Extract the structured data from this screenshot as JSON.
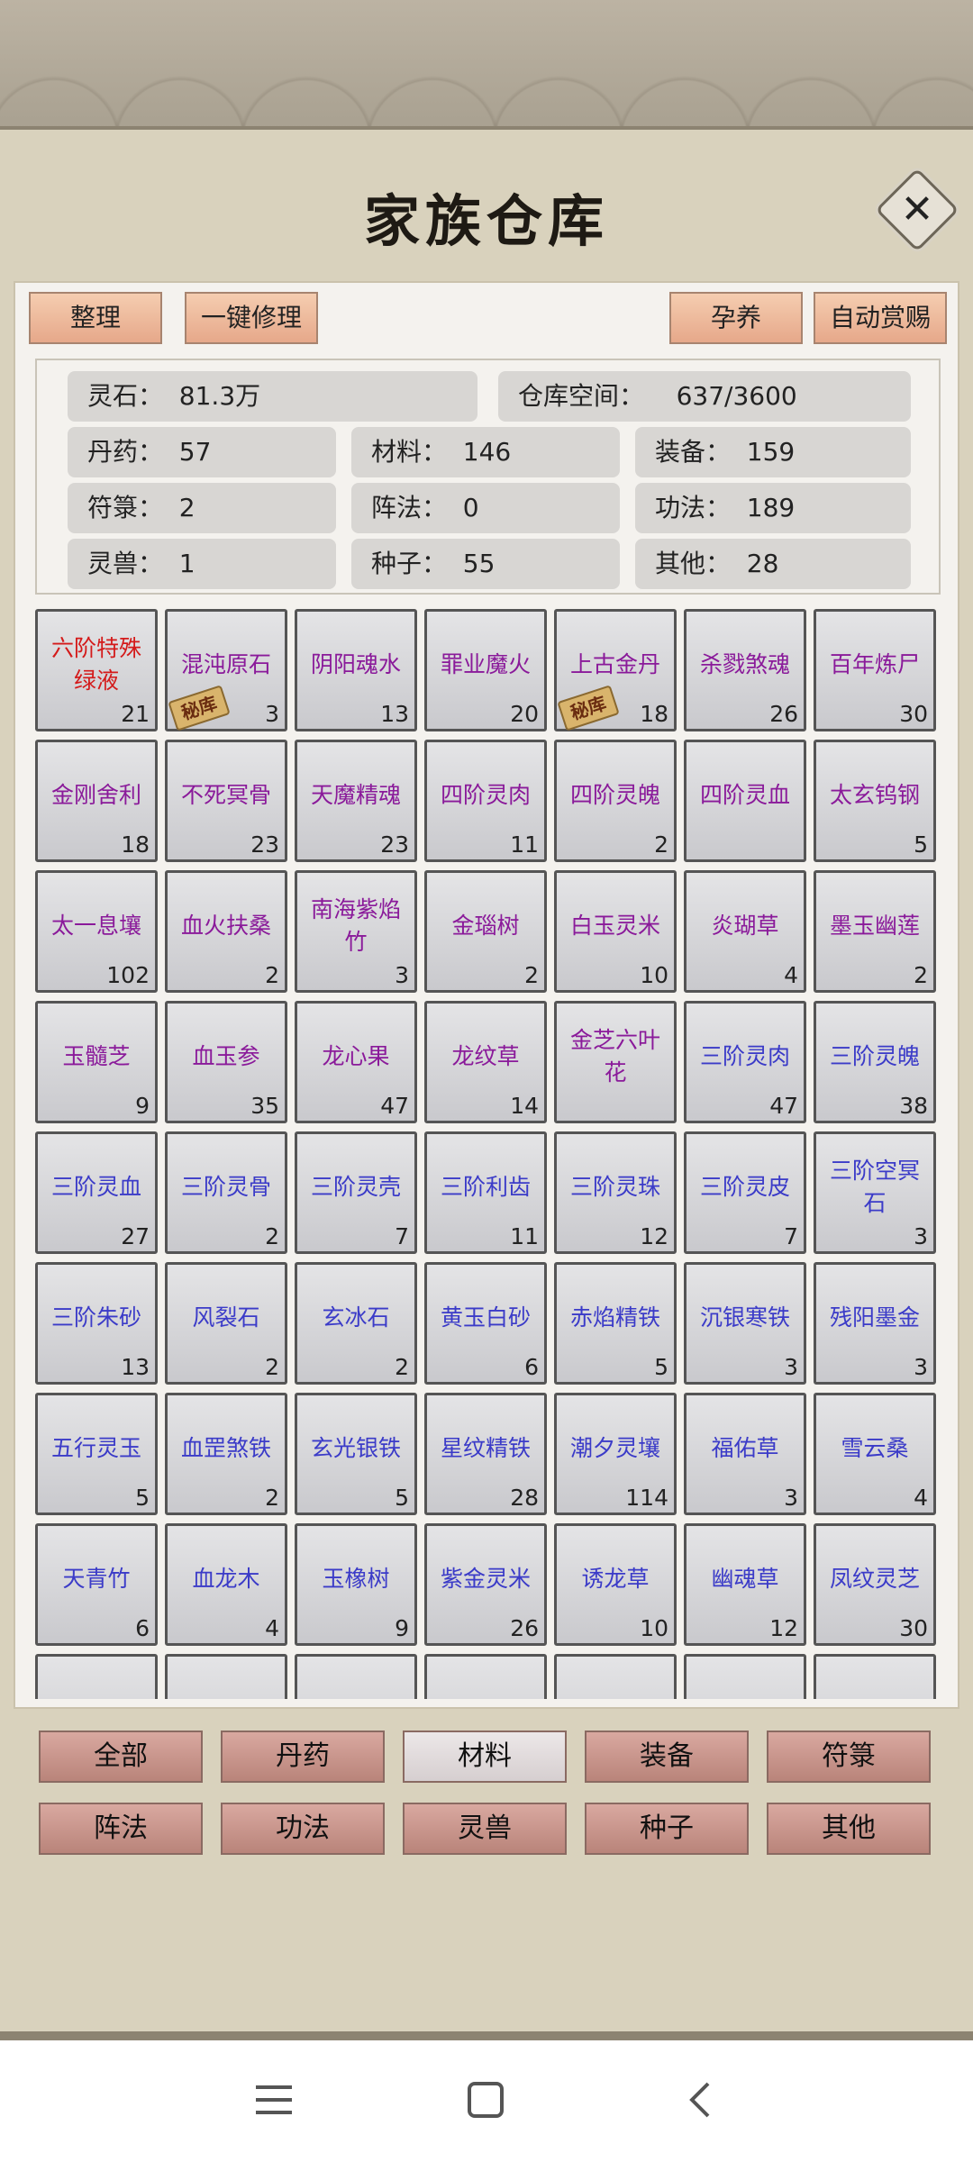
{
  "title": "家族仓库",
  "toolbar": {
    "sort": "整理",
    "repair_all": "一键修理",
    "nurture": "孕养",
    "auto_reward": "自动赏赐"
  },
  "stats": {
    "spirit_stone": "灵石：  81.3万",
    "storage": "仓库空间：    637/3600",
    "pills": "丹药：  57",
    "materials": "材料：  146",
    "equipment": "装备：  159",
    "talismans": "符箓：  2",
    "formations": "阵法：  0",
    "techniques": "功法：  189",
    "beasts": "灵兽：  1",
    "seeds": "种子：  55",
    "other": "其他：  28"
  },
  "stamp_label": "秘库",
  "items": [
    {
      "name": "六阶特殊绿液",
      "count": "21",
      "color": "#d41a1a",
      "stamp": false
    },
    {
      "name": "混沌原石",
      "count": "3",
      "color": "#8a1a9a",
      "stamp": true
    },
    {
      "name": "阴阳魂水",
      "count": "13",
      "color": "#8a1a9a",
      "stamp": false
    },
    {
      "name": "罪业魔火",
      "count": "20",
      "color": "#8a1a9a",
      "stamp": false
    },
    {
      "name": "上古金丹",
      "count": "18",
      "color": "#8a1a9a",
      "stamp": true
    },
    {
      "name": "杀戮煞魂",
      "count": "26",
      "color": "#8a1a9a",
      "stamp": false
    },
    {
      "name": "百年炼尸",
      "count": "30",
      "color": "#8a1a9a",
      "stamp": false
    },
    {
      "name": "金刚舍利",
      "count": "18",
      "color": "#8a1a9a",
      "stamp": false
    },
    {
      "name": "不死冥骨",
      "count": "23",
      "color": "#8a1a9a",
      "stamp": false
    },
    {
      "name": "天魔精魂",
      "count": "23",
      "color": "#8a1a9a",
      "stamp": false
    },
    {
      "name": "四阶灵肉",
      "count": "11",
      "color": "#8a1a9a",
      "stamp": false
    },
    {
      "name": "四阶灵魄",
      "count": "2",
      "color": "#8a1a9a",
      "stamp": false
    },
    {
      "name": "四阶灵血",
      "count": "",
      "color": "#8a1a9a",
      "stamp": false
    },
    {
      "name": "太玄钨钢",
      "count": "5",
      "color": "#8a1a9a",
      "stamp": false
    },
    {
      "name": "太一息壤",
      "count": "102",
      "color": "#8a1a9a",
      "stamp": false
    },
    {
      "name": "血火扶桑",
      "count": "2",
      "color": "#8a1a9a",
      "stamp": false
    },
    {
      "name": "南海紫焰竹",
      "count": "3",
      "color": "#8a1a9a",
      "stamp": false
    },
    {
      "name": "金瑙树",
      "count": "2",
      "color": "#8a1a9a",
      "stamp": false
    },
    {
      "name": "白玉灵米",
      "count": "10",
      "color": "#8a1a9a",
      "stamp": false
    },
    {
      "name": "炎瑚草",
      "count": "4",
      "color": "#8a1a9a",
      "stamp": false
    },
    {
      "name": "墨玉幽莲",
      "count": "2",
      "color": "#8a1a9a",
      "stamp": false
    },
    {
      "name": "玉髓芝",
      "count": "9",
      "color": "#8a1a9a",
      "stamp": false
    },
    {
      "name": "血玉参",
      "count": "35",
      "color": "#8a1a9a",
      "stamp": false
    },
    {
      "name": "龙心果",
      "count": "47",
      "color": "#8a1a9a",
      "stamp": false
    },
    {
      "name": "龙纹草",
      "count": "14",
      "color": "#8a1a9a",
      "stamp": false
    },
    {
      "name": "金芝六叶花",
      "count": "",
      "color": "#8a1a9a",
      "stamp": false
    },
    {
      "name": "三阶灵肉",
      "count": "47",
      "color": "#3b3bc8",
      "stamp": false
    },
    {
      "name": "三阶灵魄",
      "count": "38",
      "color": "#3b3bc8",
      "stamp": false
    },
    {
      "name": "三阶灵血",
      "count": "27",
      "color": "#3b3bc8",
      "stamp": false
    },
    {
      "name": "三阶灵骨",
      "count": "2",
      "color": "#3b3bc8",
      "stamp": false
    },
    {
      "name": "三阶灵壳",
      "count": "7",
      "color": "#3b3bc8",
      "stamp": false
    },
    {
      "name": "三阶利齿",
      "count": "11",
      "color": "#3b3bc8",
      "stamp": false
    },
    {
      "name": "三阶灵珠",
      "count": "12",
      "color": "#3b3bc8",
      "stamp": false
    },
    {
      "name": "三阶灵皮",
      "count": "7",
      "color": "#3b3bc8",
      "stamp": false
    },
    {
      "name": "三阶空冥石",
      "count": "3",
      "color": "#3b3bc8",
      "stamp": false
    },
    {
      "name": "三阶朱砂",
      "count": "13",
      "color": "#3b3bc8",
      "stamp": false
    },
    {
      "name": "风裂石",
      "count": "2",
      "color": "#3b3bc8",
      "stamp": false
    },
    {
      "name": "玄冰石",
      "count": "2",
      "color": "#3b3bc8",
      "stamp": false
    },
    {
      "name": "黄玉白砂",
      "count": "6",
      "color": "#3b3bc8",
      "stamp": false
    },
    {
      "name": "赤焰精铁",
      "count": "5",
      "color": "#3b3bc8",
      "stamp": false
    },
    {
      "name": "沉银寒铁",
      "count": "3",
      "color": "#3b3bc8",
      "stamp": false
    },
    {
      "name": "残阳墨金",
      "count": "3",
      "color": "#3b3bc8",
      "stamp": false
    },
    {
      "name": "五行灵玉",
      "count": "5",
      "color": "#3b3bc8",
      "stamp": false
    },
    {
      "name": "血罡煞铁",
      "count": "2",
      "color": "#3b3bc8",
      "stamp": false
    },
    {
      "name": "玄光银铁",
      "count": "5",
      "color": "#3b3bc8",
      "stamp": false
    },
    {
      "name": "星纹精铁",
      "count": "28",
      "color": "#3b3bc8",
      "stamp": false
    },
    {
      "name": "潮夕灵壤",
      "count": "114",
      "color": "#3b3bc8",
      "stamp": false
    },
    {
      "name": "福佑草",
      "count": "3",
      "color": "#3b3bc8",
      "stamp": false
    },
    {
      "name": "雪云桑",
      "count": "4",
      "color": "#3b3bc8",
      "stamp": false
    },
    {
      "name": "天青竹",
      "count": "6",
      "color": "#3b3bc8",
      "stamp": false
    },
    {
      "name": "血龙木",
      "count": "4",
      "color": "#3b3bc8",
      "stamp": false
    },
    {
      "name": "玉橡树",
      "count": "9",
      "color": "#3b3bc8",
      "stamp": false
    },
    {
      "name": "紫金灵米",
      "count": "26",
      "color": "#3b3bc8",
      "stamp": false
    },
    {
      "name": "诱龙草",
      "count": "10",
      "color": "#3b3bc8",
      "stamp": false
    },
    {
      "name": "幽魂草",
      "count": "12",
      "color": "#3b3bc8",
      "stamp": false
    },
    {
      "name": "凤纹灵芝",
      "count": "30",
      "color": "#3b3bc8",
      "stamp": false
    },
    {
      "name": "",
      "count": "",
      "color": "#3b3bc8",
      "stamp": false
    },
    {
      "name": "",
      "count": "",
      "color": "#3b3bc8",
      "stamp": false
    },
    {
      "name": "",
      "count": "",
      "color": "#3b3bc8",
      "stamp": false
    },
    {
      "name": "",
      "count": "",
      "color": "#3b3bc8",
      "stamp": false
    },
    {
      "name": "",
      "count": "",
      "color": "#3b3bc8",
      "stamp": false
    },
    {
      "name": "",
      "count": "",
      "color": "#3b3bc8",
      "stamp": false
    },
    {
      "name": "",
      "count": "",
      "color": "#3b3bc8",
      "stamp": false
    }
  ],
  "categories": [
    {
      "label": "全部",
      "active": false
    },
    {
      "label": "丹药",
      "active": false
    },
    {
      "label": "材料",
      "active": true
    },
    {
      "label": "装备",
      "active": false
    },
    {
      "label": "符箓",
      "active": false
    },
    {
      "label": "阵法",
      "active": false
    },
    {
      "label": "功法",
      "active": false
    },
    {
      "label": "灵兽",
      "active": false
    },
    {
      "label": "种子",
      "active": false
    },
    {
      "label": "其他",
      "active": false
    }
  ],
  "navbar": {
    "icons": [
      "menu-icon",
      "home-square-icon",
      "back-chevron-icon"
    ]
  }
}
